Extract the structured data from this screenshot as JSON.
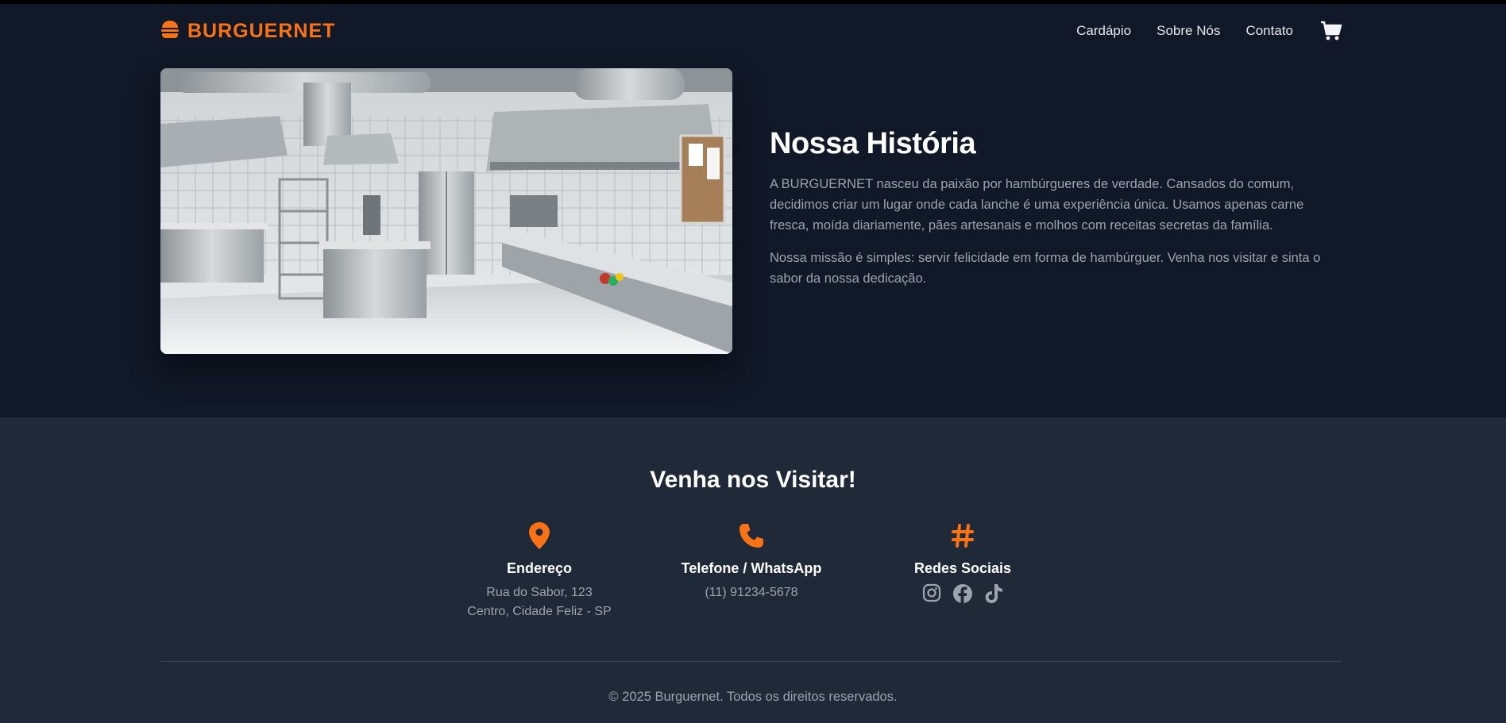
{
  "brand": {
    "name": "BURGUERNET",
    "icon": "burger-icon",
    "accent": "#f97316"
  },
  "nav": {
    "links": [
      "Cardápio",
      "Sobre Nós",
      "Contato"
    ],
    "cart_icon": "cart-icon"
  },
  "about": {
    "image": "kitchen-photo",
    "title": "Nossa História",
    "p1": "A BURGUERNET nasceu da paixão por hambúrgueres de verdade. Cansados do comum, decidimos criar um lugar onde cada lanche é uma experiência única. Usamos apenas carne fresca, moída diariamente, pães artesanais e molhos com receitas secretas da família.",
    "p2": "Nossa missão é simples: servir felicidade em forma de hambúrguer. Venha nos visitar e sinta o sabor da nossa dedicação."
  },
  "visit": {
    "title": "Venha nos Visitar!",
    "address": {
      "icon": "map-pin-icon",
      "label": "Endereço",
      "line1": "Rua do Sabor, 123",
      "line2": "Centro, Cidade Feliz - SP"
    },
    "phone": {
      "icon": "phone-icon",
      "label": "Telefone / WhatsApp",
      "number": "(11) 91234-5678"
    },
    "social": {
      "icon": "hashtag-icon",
      "label": "Redes Sociais",
      "icons": [
        "instagram-icon",
        "facebook-icon",
        "tiktok-icon"
      ]
    }
  },
  "footer": {
    "copyright": "© 2025 Burguernet. Todos os direitos reservados."
  },
  "colors": {
    "page_bg": "#111827",
    "footer_bg": "#1f2937",
    "muted_text": "#9ca3af"
  }
}
